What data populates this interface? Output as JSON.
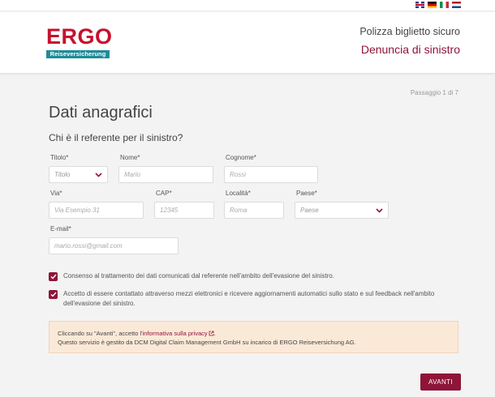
{
  "header": {
    "logo_text": "ERGO",
    "logo_subtext": "Reiseversicherung",
    "line1": "Polizza biglietto sicuro",
    "line2": "Denuncia di sinistro"
  },
  "languages": [
    "flag-en-icon",
    "flag-de-icon",
    "flag-it-icon",
    "flag-nl-icon"
  ],
  "step": "Passaggio 1 di 7",
  "title": "Dati anagrafici",
  "subtitle": "Chi è il referente per il sinistro?",
  "fields": {
    "titolo": {
      "label": "Titolo*",
      "placeholder": "Titolo"
    },
    "nome": {
      "label": "Nome*",
      "placeholder": "Mario"
    },
    "cognome": {
      "label": "Cognome*",
      "placeholder": "Rossi"
    },
    "via": {
      "label": "Via*",
      "placeholder": "Via Esempio 31"
    },
    "cap": {
      "label": "CAP*",
      "placeholder": "12345"
    },
    "localita": {
      "label": "Località*",
      "placeholder": "Roma"
    },
    "paese": {
      "label": "Paese*",
      "placeholder": "Paese"
    },
    "email": {
      "label": "E-mail*",
      "placeholder": "mario.rossi@gmail.com"
    }
  },
  "consents": [
    {
      "text": "Consenso al trattamento dei dati comunicati dal referente nell'ambito dell'evasione del sinistro.",
      "checked": true
    },
    {
      "text": "Accetto di essere contattato attraverso mezzi elettronici e ricevere aggiornamenti automatici sullo stato e sul feedback nell'ambito dell'evasione del sinistro.",
      "checked": true
    }
  ],
  "notice": {
    "prefix": "Cliccando su \"Avanti\", accetto l'",
    "link": "informativa sulla privacy",
    "suffix": ".",
    "line2": "Questo servizio è gestito da DCM Digital Claim Management GmbH su incarico di ERGO Reiseversichung AG."
  },
  "button": "AVANTI",
  "colors": {
    "brand_red": "#c8102e",
    "accent": "#8e1538",
    "teal": "#1e8c98",
    "notice_bg": "#fbe9d8"
  }
}
